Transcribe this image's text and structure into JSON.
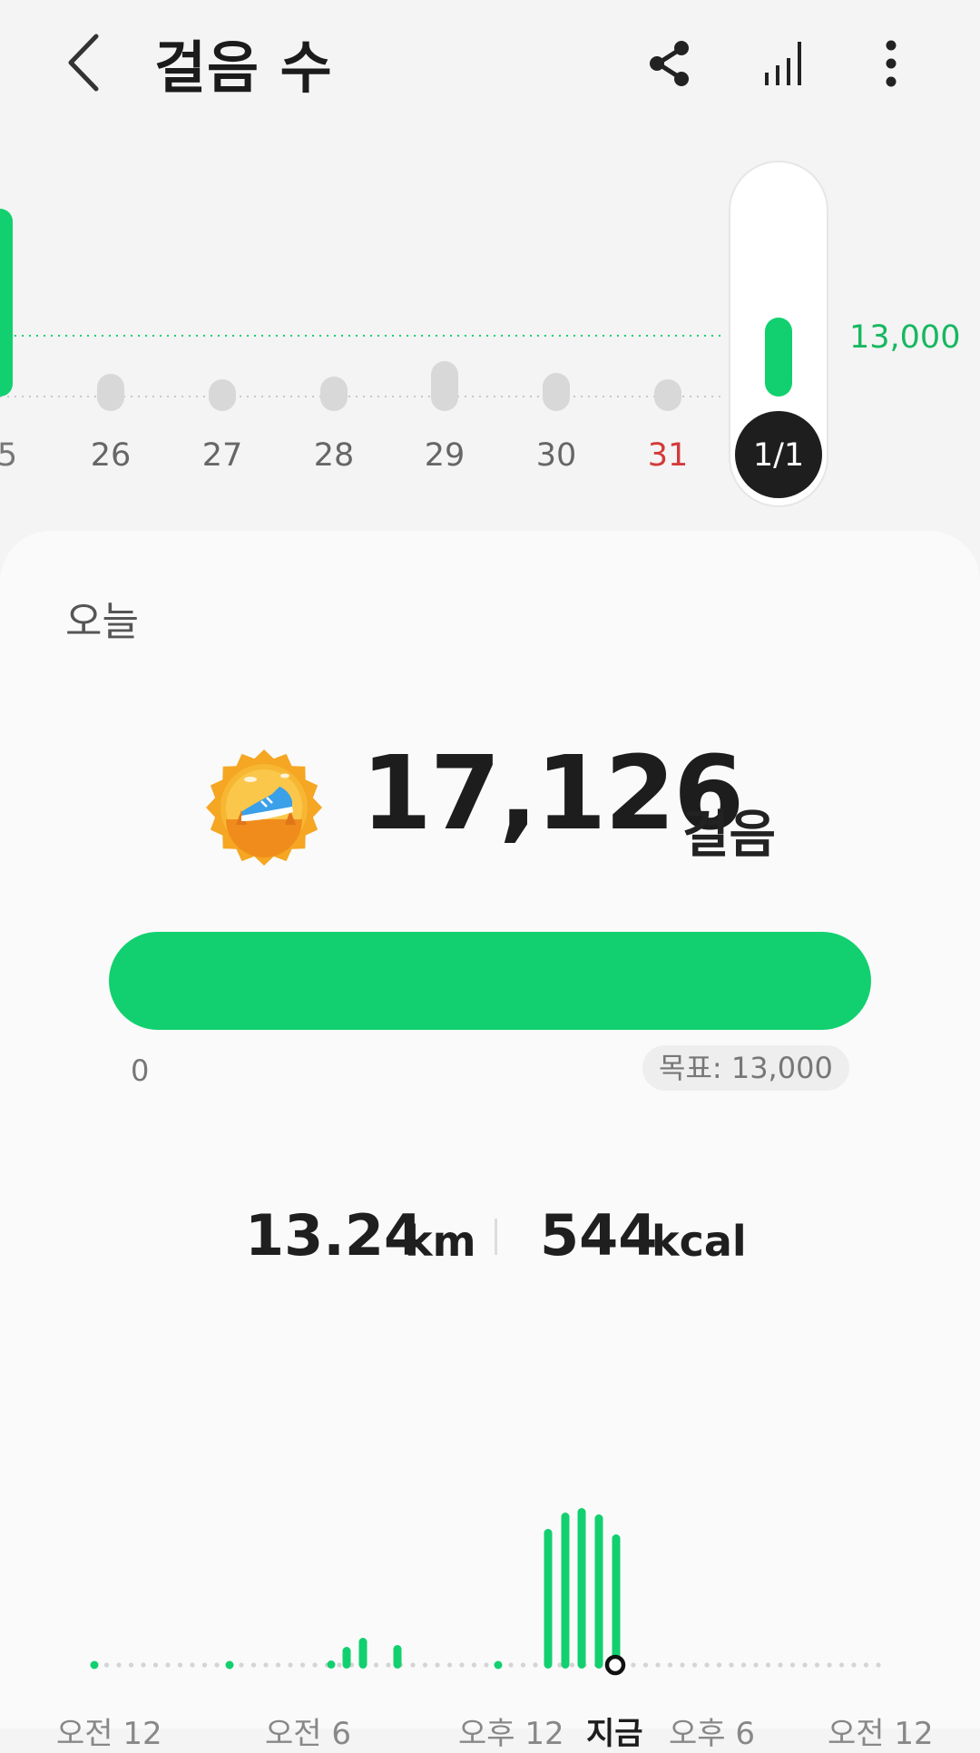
{
  "header": {
    "title": "걸음 수",
    "icons": [
      "back-icon",
      "share-icon",
      "bar-chart-icon",
      "more-vertical-icon"
    ]
  },
  "week": {
    "goal_label": "13,000",
    "days": [
      {
        "label": "5",
        "steps_level": 1.0,
        "color": "#777777"
      },
      {
        "label": "26",
        "steps_level": 0.18,
        "color": "#666666"
      },
      {
        "label": "27",
        "steps_level": 0.05,
        "color": "#666666"
      },
      {
        "label": "28",
        "steps_level": 0.12,
        "color": "#666666"
      },
      {
        "label": "29",
        "steps_level": 0.45,
        "color": "#666666"
      },
      {
        "label": "30",
        "steps_level": 0.2,
        "color": "#666666"
      },
      {
        "label": "31",
        "steps_level": 0.05,
        "color": "#d43a3a"
      },
      {
        "label": "1/1",
        "steps_level": 1.0,
        "color": "#ffffff",
        "selected": true
      }
    ]
  },
  "today": {
    "label": "오늘",
    "steps": "17,126",
    "steps_unit": "걸음",
    "progress_start": "0",
    "goal_text": "목표: 13,000",
    "progress_fraction": 1.0
  },
  "stats": {
    "distance": "13.24",
    "distance_unit": "km",
    "calories": "544",
    "calories_unit": "kcal"
  },
  "day_axis": {
    "labels": [
      "오전 12",
      "오전 6",
      "오후 12",
      "지금",
      "오후 6",
      "오전 12"
    ]
  },
  "colors": {
    "accent": "#12d06f",
    "goal_text": "#17b860",
    "weekend": "#d43a3a"
  }
}
